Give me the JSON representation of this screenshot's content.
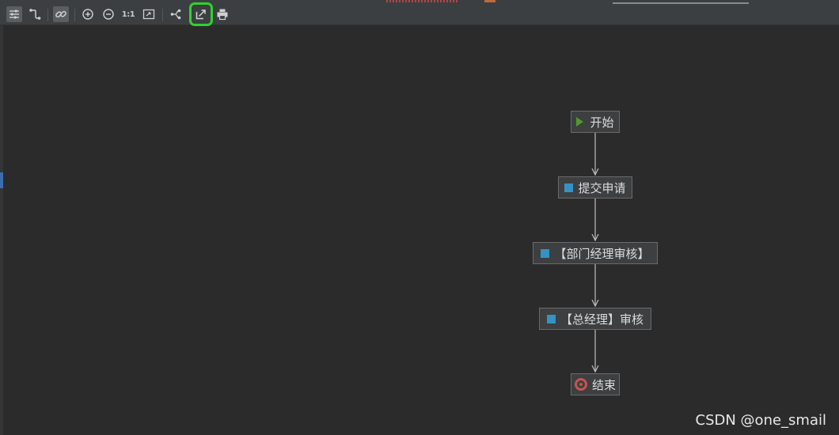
{
  "toolbar": {
    "items": [
      {
        "name": "settings-sliders-icon",
        "active": true
      },
      {
        "name": "edge-routing-icon",
        "active": false
      },
      {
        "name": "link-icon",
        "active": true
      },
      {
        "name": "zoom-in-icon",
        "active": false
      },
      {
        "name": "zoom-out-icon",
        "active": false
      },
      {
        "name": "actual-size-icon",
        "label": "1:1",
        "active": false
      },
      {
        "name": "fit-content-icon",
        "active": false
      },
      {
        "name": "layout-tree-icon",
        "active": false
      },
      {
        "name": "export-icon",
        "active": false,
        "selected": true
      },
      {
        "name": "print-icon",
        "active": false
      }
    ],
    "highlight_color": "#2fd22f"
  },
  "diagram": {
    "nodes": [
      {
        "id": "start",
        "label": "开始",
        "icon": "play-icon"
      },
      {
        "id": "submit",
        "label": "提交申请",
        "icon": "task-icon"
      },
      {
        "id": "dept",
        "label": "【部门经理审核】",
        "icon": "task-icon"
      },
      {
        "id": "gm",
        "label": "【总经理】审核",
        "icon": "task-icon"
      },
      {
        "id": "end",
        "label": "结束",
        "icon": "end-event-icon"
      }
    ],
    "edges": [
      {
        "from": "start",
        "to": "submit"
      },
      {
        "from": "submit",
        "to": "dept"
      },
      {
        "from": "dept",
        "to": "gm"
      },
      {
        "from": "gm",
        "to": "end"
      }
    ],
    "colors": {
      "start": "#4e9a2c",
      "task": "#3592c4",
      "end": "#c75450",
      "edge": "#bdbdbd"
    }
  },
  "watermark": "CSDN @one_smail"
}
